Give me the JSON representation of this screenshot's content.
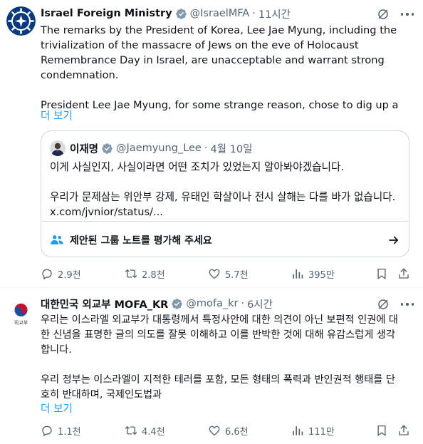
{
  "post1": {
    "name": "Israel Foreign Ministry",
    "handle": "@IsraelMFA",
    "time": "11시간",
    "body_para1": [
      "The remarks by the President of Korea, Lee Jae Myung, including the",
      "trivialization of the massacre of Jews on the eve of Holocaust",
      "Remembrance Day in Israel, are unacceptable and warrant strong",
      "condemnation."
    ],
    "body_para2": "President Lee Jae Myung, for some strange reason, chose to dig up a",
    "show_more": "더 보기",
    "quote": {
      "name": "이재명",
      "handle": "@Jaemyung_Lee",
      "time": "4월 10일",
      "line1": "이게 사실인지, 사실이라면 어떤 조치가 있었는지 알아봐야겠습니다.",
      "line2": "우리가 문제삼는 위안부 강제, 유태인 학살이나 전시 살해는 다를 바가 없습니다.",
      "line3": "x.com/jvnior/status/...",
      "community_note": "제안된 그룹 노트를 평가해 주세요"
    },
    "stats": {
      "replies": "2.9천",
      "reposts": "2.8천",
      "likes": "5.7천",
      "views": "395만"
    }
  },
  "post2": {
    "name": "대한민국 외교부 MOFA_KR",
    "handle": "@mofa_kr",
    "time": "6시간",
    "logo_text": "외교부",
    "body_para1": [
      "우리는 이스라엘 외교부가 대통령께서 특정사안에 대한 의견이 아닌 보편적 인권에 대",
      "한 신념을 표명한 글의 의도를 잘못 이해하고 이를 반박한 것에 대해 유감스럽게 생각",
      "합니다."
    ],
    "body_para2": [
      "우리 정부는 이스라엘이 지적한 테러를 포함, 모든 형태의 폭력과 반인권적 행태를 단",
      "호히 반대하며, 국제인도법과"
    ],
    "show_more": "더 보기",
    "stats": {
      "replies": "1.1천",
      "reposts": "4.4천",
      "likes": "6.6천",
      "views": "111만"
    }
  },
  "colors": {
    "link": "#1d9bf0",
    "verified": "#829aab",
    "muted": "#536471",
    "text": "#0f1419",
    "border": "#cfd9de"
  },
  "icons": [
    "verified-badge-icon",
    "grok-icon",
    "more-icon",
    "reply-icon",
    "repost-icon",
    "like-icon",
    "views-icon",
    "bookmark-icon",
    "share-icon",
    "community-notes-icon",
    "arrow-right-icon"
  ]
}
